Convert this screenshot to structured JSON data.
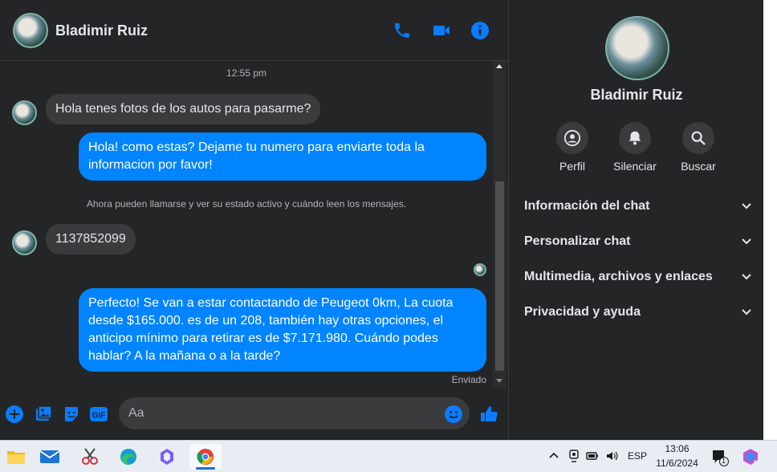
{
  "header": {
    "contact_name": "Bladimir Ruiz",
    "icons": [
      "phone-icon",
      "video-icon",
      "info-icon"
    ]
  },
  "colors": {
    "accent": "#0084ff",
    "bubble_in": "#3a3b3c",
    "background": "#242526"
  },
  "messages": {
    "timestamp": "12:55 pm",
    "items": [
      {
        "direction": "in",
        "text": "Hola tenes fotos de los autos para pasarme?"
      },
      {
        "direction": "out",
        "text": "Hola! como estas? Dejame tu numero para enviarte toda la informacion por favor!"
      },
      {
        "direction": "system",
        "text": "Ahora pueden llamarse y ver su estado activo y cuándo leen los mensajes."
      },
      {
        "direction": "in",
        "text": "1137852099"
      },
      {
        "direction": "out",
        "text": "Perfecto!  Se van a estar contactando de Peugeot 0km, La cuota desde $165.000. es de un 208, también hay otras opciones, el anticipo mínimo para retirar es de $7.171.980. Cuándo podes hablar? A la mañana o a la tarde?"
      }
    ],
    "status": "Enviado"
  },
  "composer": {
    "placeholder": "Aa",
    "icons": [
      "plus-icon",
      "image-icon",
      "sticker-icon",
      "gif-icon",
      "emoji-icon",
      "like-icon"
    ]
  },
  "side": {
    "name": "Bladimir Ruiz",
    "actions": [
      {
        "label": "Perfil",
        "icon": "profile-icon"
      },
      {
        "label": "Silenciar",
        "icon": "bell-icon"
      },
      {
        "label": "Buscar",
        "icon": "search-icon"
      }
    ],
    "sections": [
      "Información del chat",
      "Personalizar chat",
      "Multimedia, archivos y enlaces",
      "Privacidad y ayuda"
    ]
  },
  "taskbar": {
    "apps": [
      "file-explorer-icon",
      "mail-icon",
      "snipping-tool-icon",
      "edge-icon",
      "copilot-icon",
      "chrome-icon"
    ],
    "language": "ESP",
    "time": "13:06",
    "date": "11/6/2024",
    "notification_count": "1"
  }
}
